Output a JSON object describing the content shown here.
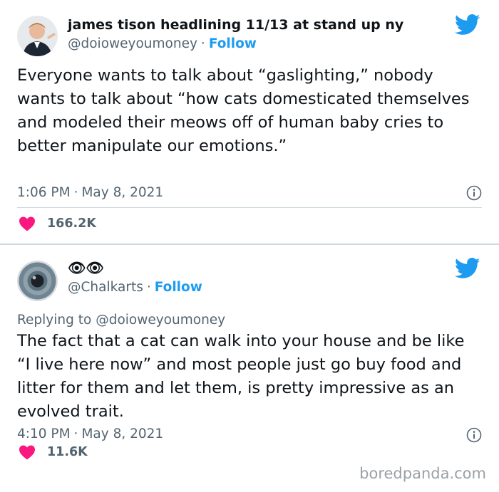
{
  "tweets": [
    {
      "display_name": "james tison headlining 11/13 at stand up ny",
      "handle": "@doioweyoumoney",
      "follow_label": "Follow",
      "text": "Everyone wants to talk about “gaslighting,” nobody wants to talk about “how cats domesticated themselves and modeled their meows off of human baby cries to better manipulate our emotions.”",
      "time": "1:06 PM",
      "date": "May 8, 2021",
      "likes": "166.2K",
      "avatar_icon": "person-avatar",
      "bird_icon": "twitter-bird-icon"
    },
    {
      "display_name": "👁👁",
      "handle": "@Chalkarts",
      "follow_label": "Follow",
      "replying_to_prefix": "Replying to",
      "replying_to": "@doioweyoumoney",
      "text": "The fact that a cat can walk into your house and be like “I live here now” and most people just go buy food and litter for them and let them, is pretty impressive as an evolved trait.",
      "time": "4:10 PM",
      "date": "May 8, 2021",
      "likes": "11.6K",
      "avatar_icon": "eye-iris-avatar",
      "bird_icon": "twitter-bird-icon"
    }
  ],
  "separator": "·",
  "watermark": "boredpanda.com",
  "colors": {
    "twitter_blue": "#1d9bf0",
    "heart_pink": "#f91880",
    "secondary_text": "#536471",
    "divider": "#cfd9de"
  }
}
